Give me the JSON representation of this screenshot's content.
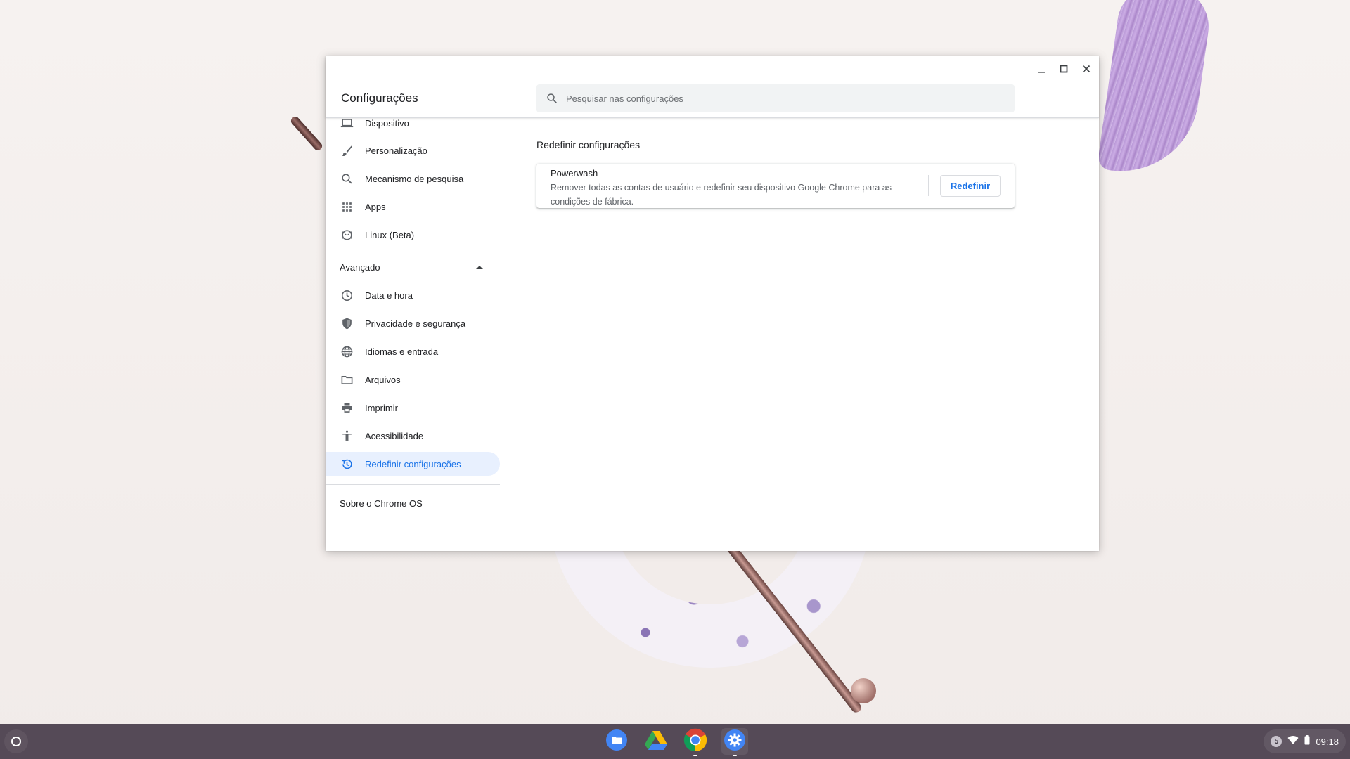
{
  "window": {
    "title": "Configurações",
    "controls": [
      "minimize-icon",
      "maximize-icon",
      "close-icon"
    ]
  },
  "search": {
    "placeholder": "Pesquisar nas configurações",
    "value": ""
  },
  "sidebar": {
    "items": [
      {
        "label": "Dispositivo",
        "icon": "laptop-icon"
      },
      {
        "label": "Personalização",
        "icon": "brush-icon"
      },
      {
        "label": "Mecanismo de pesquisa",
        "icon": "search-icon"
      },
      {
        "label": "Apps",
        "icon": "apps-grid-icon"
      },
      {
        "label": "Linux (Beta)",
        "icon": "linux-icon"
      }
    ],
    "advanced_label": "Avançado",
    "advanced_items": [
      {
        "label": "Data e hora",
        "icon": "clock-icon"
      },
      {
        "label": "Privacidade e segurança",
        "icon": "shield-icon"
      },
      {
        "label": "Idiomas e entrada",
        "icon": "globe-icon"
      },
      {
        "label": "Arquivos",
        "icon": "folder-icon"
      },
      {
        "label": "Imprimir",
        "icon": "printer-icon"
      },
      {
        "label": "Acessibilidade",
        "icon": "accessibility-icon"
      },
      {
        "label": "Redefinir configurações",
        "icon": "restore-icon",
        "active": true
      }
    ],
    "about": "Sobre o Chrome OS"
  },
  "main": {
    "section_title": "Redefinir configurações",
    "card": {
      "title": "Powerwash",
      "description": "Remover todas as contas de usuário e redefinir seu dispositivo Google Chrome para as condições de fábrica.",
      "button_label": "Redefinir"
    }
  },
  "shelf": {
    "apps": [
      {
        "name": "Files",
        "icon": "files-icon"
      },
      {
        "name": "Google Drive",
        "icon": "drive-icon"
      },
      {
        "name": "Chrome",
        "icon": "chrome-icon",
        "running": true
      },
      {
        "name": "Settings",
        "icon": "settings-icon",
        "running": true
      }
    ],
    "status": {
      "notification_count": "5",
      "time": "09:18"
    }
  },
  "colors": {
    "accent": "#1a73e8",
    "active_bg": "#e8f0fe",
    "shelf_bg": "#4a404e"
  }
}
